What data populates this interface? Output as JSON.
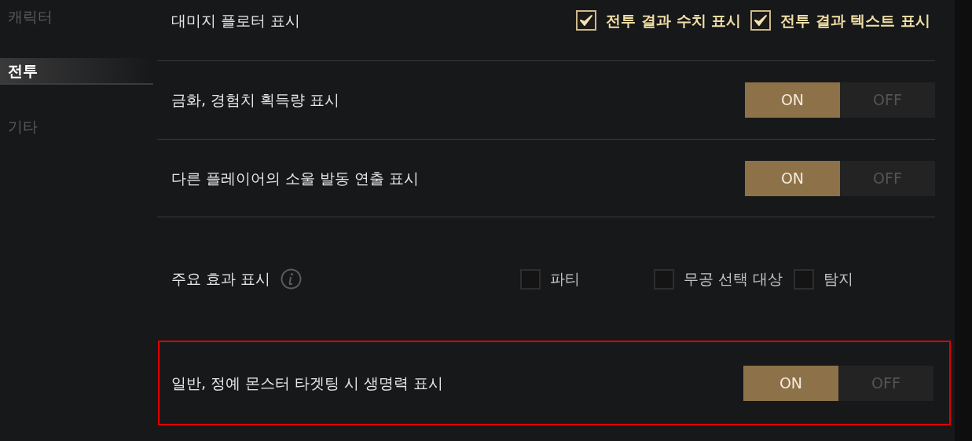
{
  "sidebar": {
    "items": [
      {
        "label": "캐릭터",
        "selected": false
      },
      {
        "label": "전투",
        "selected": true
      },
      {
        "label": "기타",
        "selected": false
      }
    ]
  },
  "settings": [
    {
      "kind": "checkboxes",
      "label": "대미지 플로터 표시",
      "highlighted": false,
      "options": [
        {
          "label": "전투 결과 수치 표시",
          "checked": true
        },
        {
          "label": "전투 결과 텍스트 표시",
          "checked": true
        }
      ]
    },
    {
      "kind": "toggle",
      "label": "금화, 경험치 획득량 표시",
      "highlighted": false,
      "on": true,
      "on_label": "ON",
      "off_label": "OFF"
    },
    {
      "kind": "toggle",
      "label": "다른 플레이어의 소울 발동 연출 표시",
      "highlighted": false,
      "on": true,
      "on_label": "ON",
      "off_label": "OFF"
    },
    {
      "kind": "checkboxes",
      "label": "주요 효과 표시",
      "info": true,
      "highlighted": false,
      "options": [
        {
          "label": "파티",
          "checked": false
        },
        {
          "label": "무공 선택 대상",
          "checked": false
        },
        {
          "label": "탐지",
          "checked": false
        }
      ]
    },
    {
      "kind": "toggle",
      "label": "일반, 정예 몬스터 타겟팅 시 생명력 표시",
      "highlighted": true,
      "on": true,
      "on_label": "ON",
      "off_label": "OFF"
    }
  ]
}
